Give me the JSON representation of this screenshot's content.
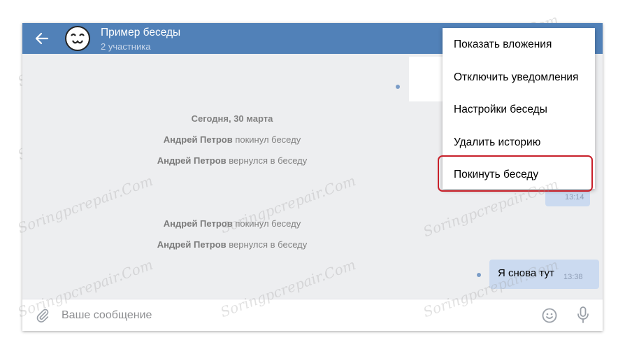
{
  "header": {
    "title": "Пример беседы",
    "subtitle": "2 участника"
  },
  "messages": {
    "date": "Сегодня, 30 марта",
    "events": [
      {
        "name": "Андрей Петров",
        "action": "покинул беседу"
      },
      {
        "name": "Андрей Петров",
        "action": "вернулся в беседу"
      },
      {
        "name": "Андрей Петров",
        "action": "покинул беседу"
      },
      {
        "name": "Андрей Петров",
        "action": "вернулся в беседу"
      }
    ],
    "partial_time": "13:14",
    "outgoing": {
      "text": "Я снова тут",
      "time": "13:38"
    }
  },
  "composer": {
    "placeholder": "Ваше сообщение"
  },
  "menu": {
    "items": [
      "Показать вложения",
      "Отключить уведомления",
      "Настройки беседы",
      "Удалить историю",
      "Покинуть беседу"
    ],
    "highlighted_index": 4
  },
  "watermark": "Soringpcrepair.Com",
  "colors": {
    "header": "#5181b8",
    "background": "#edeef0",
    "outgoing_bubble": "#cbdaf0",
    "highlight": "#c8202a"
  },
  "icons": [
    "back-arrow-icon",
    "avatar-icon",
    "paperclip-icon",
    "smile-icon",
    "microphone-icon"
  ]
}
